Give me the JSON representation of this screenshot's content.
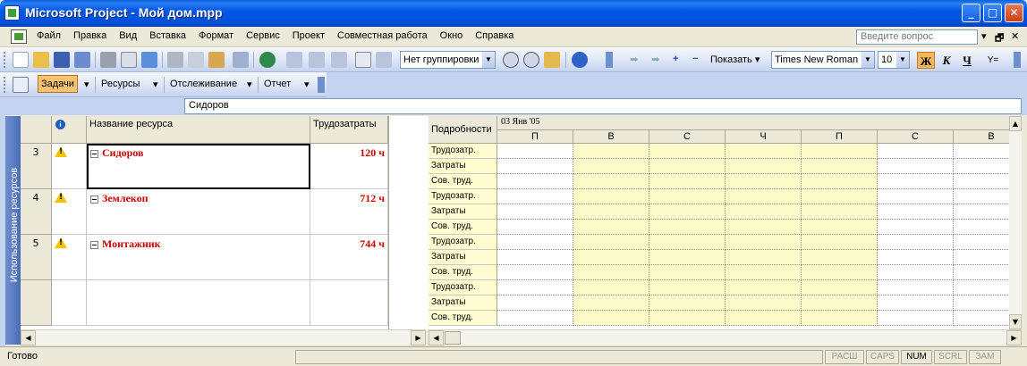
{
  "window": {
    "title": "Microsoft Project - Мой дом.mpp",
    "min_label": "_",
    "max_label": "□",
    "close_label": "✕"
  },
  "menu": {
    "items": [
      "Файл",
      "Правка",
      "Вид",
      "Вставка",
      "Формат",
      "Сервис",
      "Проект",
      "Совместная работа",
      "Окно",
      "Справка"
    ],
    "ask_placeholder": "Введите вопрос",
    "ctrl_min": "▾",
    "ctrl_restore": "🗗",
    "ctrl_close": "✕"
  },
  "toolbar_standard": {
    "grouping_value": "Нет группировки",
    "show_label": "Показать",
    "font_name": "Times New Roman",
    "font_size": "10",
    "bold_label": "Ж",
    "italic_label": "К",
    "underline_label": "Ч",
    "filter_label": "Y="
  },
  "toolbar_guide": {
    "tasks_label": "Задачи",
    "resources_label": "Ресурсы",
    "tracking_label": "Отслеживание",
    "report_label": "Отчет"
  },
  "entry": {
    "value": "Сидоров"
  },
  "view_bar": {
    "label": "Использование ресурсов"
  },
  "left_table": {
    "columns": {
      "indicator_icon": "info-icon",
      "name": "Название ресурса",
      "work": "Трудозатраты"
    },
    "rows": [
      {
        "id": "3",
        "name": "Сидоров",
        "work": "120 ч"
      },
      {
        "id": "4",
        "name": "Землекоп",
        "work": "712 ч"
      },
      {
        "id": "5",
        "name": "Монтажник",
        "work": "744 ч"
      }
    ]
  },
  "timescale": {
    "detail_header": "Подробности",
    "week_label": "03 Янв '05",
    "days": [
      "П",
      "В",
      "С",
      "Ч",
      "П",
      "С",
      "В"
    ],
    "day_types": [
      "nonwork",
      "work",
      "work",
      "work",
      "work",
      "nonwork",
      "nonwork"
    ],
    "detail_labels": [
      "Трудозатр.",
      "Затраты",
      "Сов. труд.",
      "Трудозатр.",
      "Затраты",
      "Сов. труд.",
      "Трудозатр.",
      "Затраты",
      "Сов. труд.",
      "Трудозатр.",
      "Затраты",
      "Сов. труд."
    ]
  },
  "status": {
    "text": "Готово",
    "indicators": [
      {
        "label": "РАСШ",
        "on": false
      },
      {
        "label": "CAPS",
        "on": false
      },
      {
        "label": "NUM",
        "on": true
      },
      {
        "label": "SCRL",
        "on": false
      },
      {
        "label": "ЗАМ",
        "on": false
      }
    ]
  },
  "colors": {
    "title_bar": "#0055e5",
    "resource_overallocated": "#cc0000",
    "work_day_fill": "#fdfbc8",
    "detail_label_fill": "#fffdd0"
  }
}
